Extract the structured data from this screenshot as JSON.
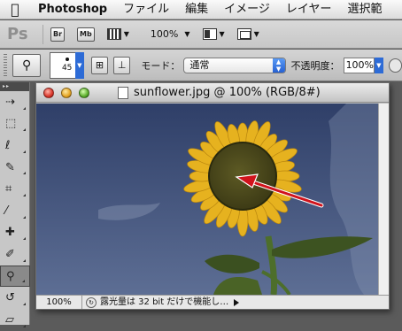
{
  "menubar": {
    "app_name": "Photoshop",
    "items": [
      {
        "label": "ファイル"
      },
      {
        "label": "編集"
      },
      {
        "label": "イメージ"
      },
      {
        "label": "レイヤー"
      },
      {
        "label": "選択範"
      }
    ]
  },
  "appbar": {
    "logo": "Ps",
    "bridge_label": "Br",
    "minibridge_label": "Mb",
    "zoom_level": "100%"
  },
  "options": {
    "brush_size": "45",
    "mode_label": "モード：",
    "mode_value": "通常",
    "opacity_label": "不透明度：",
    "opacity_value": "100%"
  },
  "document": {
    "title": "sunflower.jpg @ 100% (RGB/8#)",
    "zoom": "100%",
    "status_text": "露光量は 32 bit だけで機能し…",
    "colors": {
      "sky_top": "#2f3f68",
      "sky_bottom": "#5d6e94",
      "petal": "#e6b21f",
      "center": "#4c4a1c",
      "leaf": "#3d5321",
      "arrow": "#d0131c"
    }
  }
}
